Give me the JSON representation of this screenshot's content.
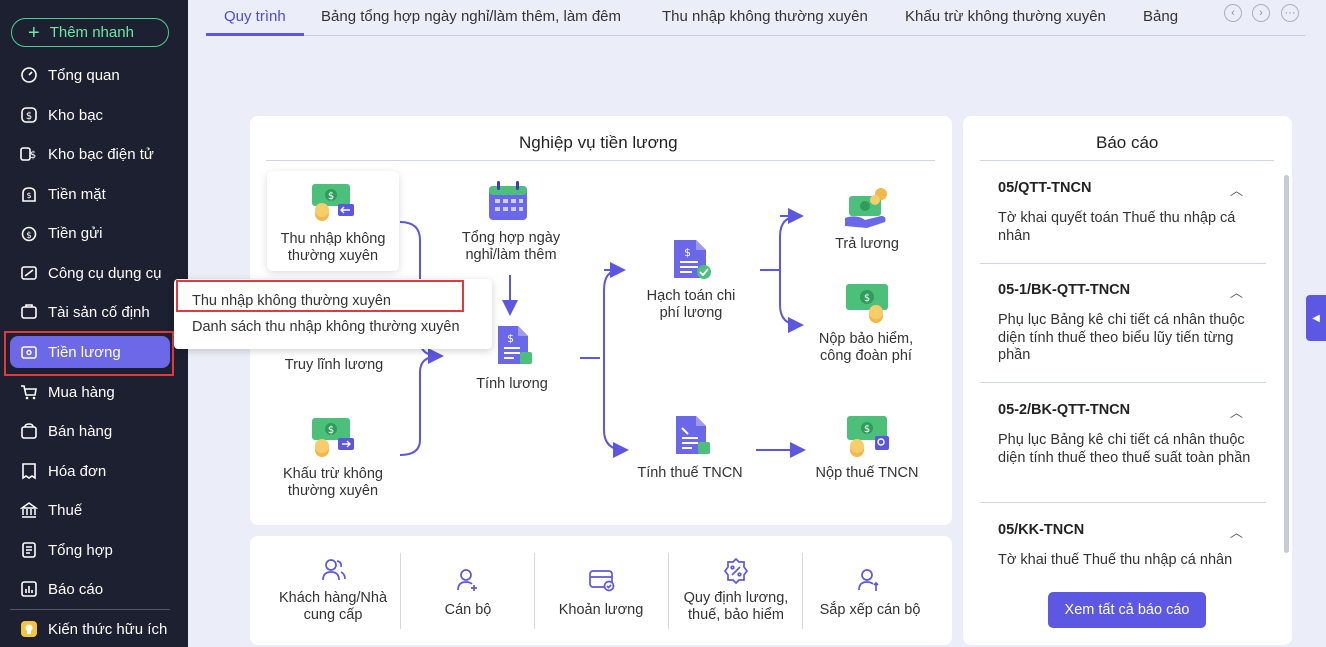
{
  "sidebar": {
    "quick_add": "Thêm nhanh",
    "items": [
      {
        "label": "Tổng quan",
        "icon": "dashboard-icon"
      },
      {
        "label": "Kho bạc",
        "icon": "treasury-icon"
      },
      {
        "label": "Kho bạc điện tử",
        "icon": "e-treasury-icon"
      },
      {
        "label": "Tiền mặt",
        "icon": "cash-icon"
      },
      {
        "label": "Tiền gửi",
        "icon": "deposit-icon"
      },
      {
        "label": "Công cụ dụng cụ",
        "icon": "tools-icon"
      },
      {
        "label": "Tài sản cố định",
        "icon": "fixed-asset-icon"
      },
      {
        "label": "Tiền lương",
        "icon": "salary-icon"
      },
      {
        "label": "Mua hàng",
        "icon": "purchase-icon"
      },
      {
        "label": "Bán hàng",
        "icon": "sales-icon"
      },
      {
        "label": "Hóa đơn",
        "icon": "invoice-icon"
      },
      {
        "label": "Thuế",
        "icon": "tax-icon"
      },
      {
        "label": "Tổng hợp",
        "icon": "summary-icon"
      },
      {
        "label": "Báo cáo",
        "icon": "report-icon"
      },
      {
        "label": "Kiến thức hữu ích",
        "icon": "knowledge-icon"
      }
    ],
    "active_index": 7
  },
  "tabs": [
    "Quy trình",
    "Bảng tổng hợp ngày nghỉ/làm thêm, làm đêm",
    "Thu nhập không thường xuyên",
    "Khấu trừ không thường xuyên",
    "Bảng"
  ],
  "workflow": {
    "title": "Nghiệp vụ tiền lương",
    "nodes": {
      "irregular_income": "Thu nhập không thường xuyên",
      "overtime_summary": "Tổng hợp ngày nghỉ/làm thêm",
      "salary_accounting": "Hạch toán chi phí lương",
      "pay_salary": "Trả lương",
      "insurance": "Nộp bảo hiểm, công đoàn phí",
      "salary_retrieval": "Truy lĩnh lương",
      "calc_salary": "Tính lương",
      "irregular_deduction": "Khấu trừ không thường xuyên",
      "calc_pit": "Tính thuế TNCN",
      "pay_pit": "Nộp thuế TNCN"
    }
  },
  "popup": {
    "items": [
      "Thu nhập không thường xuyên",
      "Danh sách thu nhập không thường xuyên"
    ]
  },
  "bottom": [
    {
      "label": "Khách hàng/Nhà cung cấp",
      "icon": "customers-icon"
    },
    {
      "label": "Cán bộ",
      "icon": "staff-add-icon"
    },
    {
      "label": "Khoản lương",
      "icon": "salary-item-icon"
    },
    {
      "label": "Quy định lương, thuế, bảo hiểm",
      "icon": "regulation-icon"
    },
    {
      "label": "Sắp xếp cán bộ",
      "icon": "staff-sort-icon"
    }
  ],
  "reports": {
    "title": "Báo cáo",
    "items": [
      {
        "code": "05/QTT-TNCN",
        "desc": "Tờ khai quyết toán Thuế thu nhập cá nhân"
      },
      {
        "code": "05-1/BK-QTT-TNCN",
        "desc": "Phụ lục Bảng kê chi tiết cá nhân thuộc diện tính thuế theo biểu lũy tiến từng phần"
      },
      {
        "code": "05-2/BK-QTT-TNCN",
        "desc": "Phụ lục Bảng kê chi tiết cá nhân thuộc diện tính thuế theo thuế suất toàn phần"
      },
      {
        "code": "05/KK-TNCN",
        "desc": "Tờ khai thuế Thuế thu nhập cá nhân"
      }
    ],
    "see_all": "Xem tất cả báo cáo"
  },
  "colors": {
    "accent": "#5c58e3",
    "sidebar": "#1c2030",
    "highlight": "#e0393e",
    "money": "#4cbf7a",
    "coin": "#f2b84b"
  }
}
